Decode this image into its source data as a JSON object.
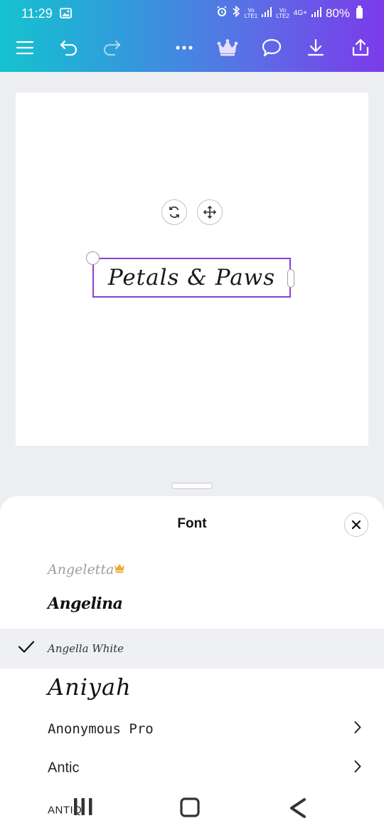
{
  "status": {
    "time": "11:29",
    "sim1_tag_top": "Vo",
    "sim1_tag_bottom": "LTE1",
    "sim2_tag_top": "Vo",
    "sim2_tag_bottom": "LTE2",
    "network": "4G+",
    "battery": "80%"
  },
  "toolbar": {
    "icons": [
      "menu-icon",
      "undo-icon",
      "redo-icon",
      "more-icon",
      "crown-icon",
      "comment-icon",
      "download-icon",
      "share-icon"
    ]
  },
  "canvas": {
    "text": "Petals & Paws"
  },
  "sheet": {
    "title": "Font",
    "fonts": [
      {
        "name": "Angeletta",
        "premium": true,
        "selected": false,
        "expandable": false
      },
      {
        "name": "Angelina",
        "premium": false,
        "selected": false,
        "expandable": false
      },
      {
        "name": "Angella White",
        "premium": false,
        "selected": true,
        "expandable": false
      },
      {
        "name": "Aniyah",
        "premium": false,
        "selected": false,
        "expandable": false
      },
      {
        "name": "Anonymous Pro",
        "premium": false,
        "selected": false,
        "expandable": true
      },
      {
        "name": "Antic",
        "premium": false,
        "selected": false,
        "expandable": true
      },
      {
        "name": "ANTIQ",
        "premium": false,
        "selected": false,
        "expandable": false
      }
    ]
  },
  "colors": {
    "gradient_start": "#14c3cf",
    "gradient_end": "#7c3aea",
    "selection": "#8b3fd9",
    "crown_gold": "#f0a93a"
  }
}
